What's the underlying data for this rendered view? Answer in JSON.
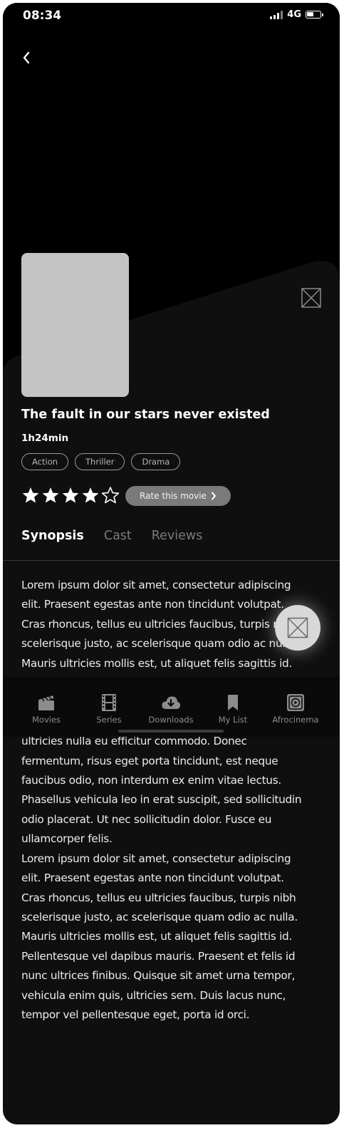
{
  "status_bar": {
    "time": "08:34",
    "network": "4G"
  },
  "movie": {
    "title": "The fault in our stars never existed",
    "duration": "1h24min",
    "genres": [
      "Action",
      "Thriller",
      "Drama"
    ],
    "rating": {
      "value": 4,
      "max": 5
    },
    "rate_label": "Rate this movie"
  },
  "tabs": [
    {
      "label": "Synopsis",
      "active": true
    },
    {
      "label": "Cast",
      "active": false
    },
    {
      "label": "Reviews",
      "active": false
    }
  ],
  "synopsis": "Lorem ipsum dolor sit amet, consectetur adipiscing\nelit. Praesent egestas ante non tincidunt volutpat.\nCras rhoncus, tellus eu ultricies faucibus, turpis nibh\nscelerisque justo, ac scelerisque quam odio ac nulla.\nMauris ultricies mollis est, ut aliquet felis sagittis id.\nPellentesque vel dapibus mauris. Praesent et felis id\nnunc ultrices finibus. Quisque sit amet urna tempor,\ntempor vel pellentesque eget, porta id orci. Phasellus\nultricies nulla eu efficitur commodo. Donec\nfermentum, risus eget porta tincidunt, est neque\nfaucibus odio, non interdum ex enim vitae lectus.\nPhasellus vehicula leo in erat suscipit, sed sollicitudin\nodio placerat. Ut nec sollicitudin dolor. Fusce eu\nullamcorper felis.\nLorem ipsum dolor sit amet, consectetur adipiscing\nelit. Praesent egestas ante non tincidunt volutpat.\nCras rhoncus, tellus eu ultricies faucibus, turpis nibh\nscelerisque justo, ac scelerisque quam odio ac nulla.\nMauris ultricies mollis est, ut aliquet felis sagittis id.\nPellentesque vel dapibus mauris. Praesent et felis id\nnunc ultrices finibus. Quisque sit amet urna tempor,\nvehicula enim quis, ultricies sem. Duis lacus nunc,\ntempor vel pellentesque eget, porta id orci.",
  "bottom_nav": [
    {
      "label": "Movies",
      "icon": "clapperboard-icon"
    },
    {
      "label": "Series",
      "icon": "film-strip-icon"
    },
    {
      "label": "Downloads",
      "icon": "cloud-download-icon"
    },
    {
      "label": "My List",
      "icon": "bookmark-icon"
    },
    {
      "label": "Afrocinema",
      "icon": "play-tile-icon"
    }
  ],
  "colors": {
    "background": "#0f0f0f",
    "hero": "#000000",
    "poster_placeholder": "#c4c4c4",
    "rate_button": "#7a7a7a",
    "nav_label": "#8c8c8c"
  }
}
